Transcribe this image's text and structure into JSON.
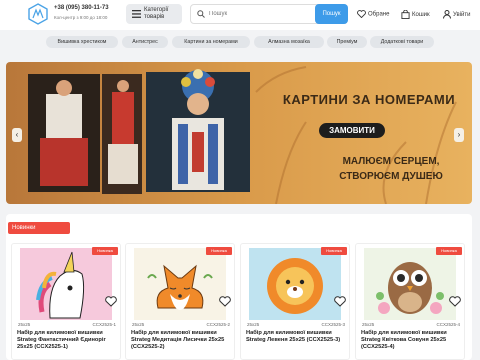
{
  "header": {
    "phone": "+38 (095) 380-11-73",
    "hours": "Кол-центр з 9:00 до 18:00",
    "category_label": "Категорії товарів",
    "search_placeholder": "Пошук",
    "search_button": "Пошук",
    "favorites": "Обране",
    "cart": "Кошик",
    "login": "Увійти",
    "accent_color": "#3d9be9"
  },
  "tags": [
    "Вишивка хрестиком",
    "Антистрес",
    "Картини за номерами",
    "Алмазна мозаїка",
    "Преміум",
    "Додаткові товари"
  ],
  "banner": {
    "headline": "КАРТИНИ ЗА НОМЕРАМИ",
    "cta": "ЗАМОВИТИ",
    "slogan_line1": "МАЛЮЄМ СЕРЦЕМ,",
    "slogan_line2": "СТВОРЮЄМ ДУШЕЮ",
    "prev": "‹",
    "next": "›"
  },
  "section": {
    "title": "Новинки",
    "badge_color": "#ef4b3f"
  },
  "products": [
    {
      "badge": "Новинка",
      "size": "25x25",
      "sku": "CCX2525-1",
      "title": "Набір для килимової вишивки Strateg Фантастичний Єдиноріг 25x25 (CCX2525-1)",
      "price": "..."
    },
    {
      "badge": "Новинка",
      "size": "25x25",
      "sku": "CCX2525-2",
      "title": "Набір для килимової вишивки Strateg Медитація Лисички 25x25 (CCX2525-2)",
      "price": "..."
    },
    {
      "badge": "Новинка",
      "size": "25x25",
      "sku": "CCX2525-3",
      "title": "Набір для килимової вишивки Strateg Левеня 25x25 (CCX2525-3)",
      "price": "..."
    },
    {
      "badge": "Новинка",
      "size": "25x25",
      "sku": "CCX2525-4",
      "title": "Набір для килимової вишивки Strateg Квіткова Совуня 25x25 (CCX2525-4)",
      "price": "..."
    }
  ]
}
